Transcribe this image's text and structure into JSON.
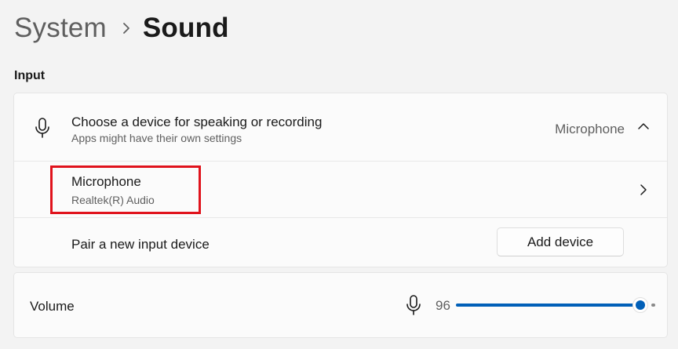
{
  "breadcrumb": {
    "parent": "System",
    "current": "Sound"
  },
  "input_section": {
    "label": "Input",
    "device_chooser": {
      "title": "Choose a device for speaking or recording",
      "subtitle": "Apps might have their own settings",
      "selected": "Microphone",
      "expanded": true
    },
    "device": {
      "name": "Microphone",
      "driver": "Realtek(R) Audio",
      "highlight_color": "#e0131c"
    },
    "pair": {
      "label": "Pair a new input device",
      "button_label": "Add device"
    }
  },
  "volume": {
    "label": "Volume",
    "value": "96",
    "level_percent": 96,
    "accent_color": "#005fb8"
  },
  "icons": [
    "chevron-right-icon",
    "microphone-icon",
    "chevron-up-icon",
    "chevron-right-icon",
    "microphone-icon"
  ]
}
